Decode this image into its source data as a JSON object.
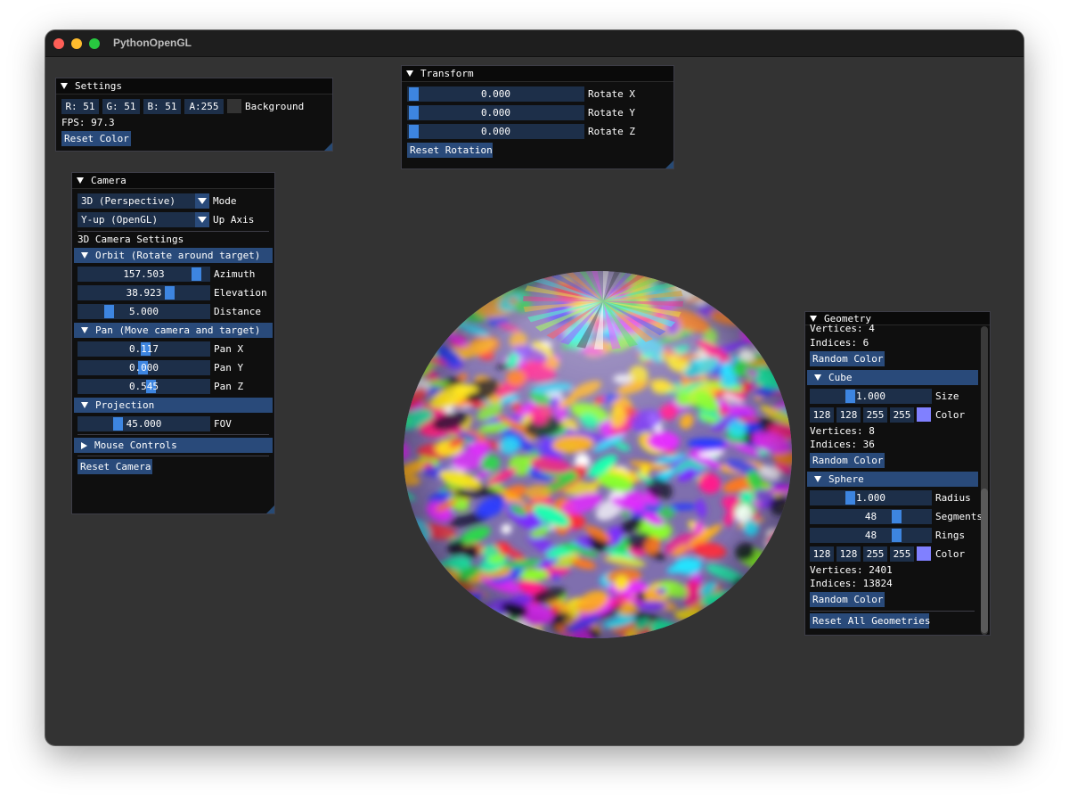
{
  "window": {
    "title": "PythonOpenGL",
    "traffic_lights": {
      "close": "#fe5f57",
      "minimize": "#febc2e",
      "zoom": "#28c840"
    },
    "background_color": "#333333"
  },
  "settings": {
    "title": "Settings",
    "r": "R: 51",
    "g": "G: 51",
    "b": "B: 51",
    "a": "A:255",
    "background_swatch": "#333333",
    "background_label": "Background",
    "fps": "FPS: 97.3",
    "reset_color": "Reset Color"
  },
  "transform": {
    "title": "Transform",
    "rows": [
      {
        "value": "0.000",
        "label": "Rotate X"
      },
      {
        "value": "0.000",
        "label": "Rotate Y"
      },
      {
        "value": "0.000",
        "label": "Rotate Z"
      }
    ],
    "reset": "Reset Rotation"
  },
  "camera": {
    "title": "Camera",
    "mode_value": "3D (Perspective)",
    "mode_label": "Mode",
    "up_value": "Y-up (OpenGL)",
    "up_label": "Up Axis",
    "settings_label": "3D Camera Settings",
    "orbit_header": "Orbit (Rotate around target)",
    "azimuth": {
      "value": "157.503",
      "label": "Azimuth"
    },
    "elevation": {
      "value": "38.923",
      "label": "Elevation"
    },
    "distance": {
      "value": "5.000",
      "label": "Distance"
    },
    "pan_header": "Pan (Move camera and target)",
    "pan_x": {
      "value": "0.117",
      "label": "Pan X"
    },
    "pan_y": {
      "value": "0.000",
      "label": "Pan Y"
    },
    "pan_z": {
      "value": "0.545",
      "label": "Pan Z"
    },
    "projection_header": "Projection",
    "fov": {
      "value": "45.000",
      "label": "FOV"
    },
    "mouse_header": "Mouse Controls",
    "reset": "Reset Camera"
  },
  "geometry": {
    "title": "Geometry",
    "top_vertices": "Vertices: 4",
    "top_indices": "Indices: 6",
    "top_random": "Random Color",
    "cube_header": "Cube",
    "cube_size": {
      "value": "1.000",
      "label": "Size"
    },
    "cube_color": {
      "r": "128",
      "g": "128",
      "b": "255",
      "a": "255",
      "swatch": "#8080ff",
      "label": "Color"
    },
    "cube_vertices": "Vertices: 8",
    "cube_indices": "Indices: 36",
    "cube_random": "Random Color",
    "sphere_header": "Sphere",
    "sphere_radius": {
      "value": "1.000",
      "label": "Radius"
    },
    "sphere_segments": {
      "value": "48",
      "label": "Segments"
    },
    "sphere_rings": {
      "value": "48",
      "label": "Rings"
    },
    "sphere_color": {
      "r": "128",
      "g": "128",
      "b": "255",
      "a": "255",
      "swatch": "#8080ff",
      "label": "Color"
    },
    "sphere_vertices": "Vertices: 2401",
    "sphere_indices": "Indices: 13824",
    "sphere_random": "Random Color",
    "reset_all": "Reset All Geometries"
  }
}
